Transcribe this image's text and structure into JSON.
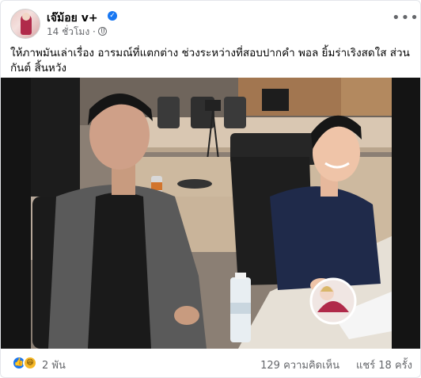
{
  "post": {
    "author": "เจ๊ม้อย v+",
    "time": "14 ชั่วโมง",
    "privacy_icon": "globe-icon",
    "verified_icon": "verified-badge-icon",
    "caption": "ให้ภาพมันเล่าเรื่อง อารมณ์ที่แตกต่าง  ช่วงระหว่างที่สอบปากคำ พอล ยิ้มร่าเริงสดใส ส่วน กันต์ สิ้นหวัง",
    "photo_description_icon": "post-photo",
    "overlay_avatar_icon": "watermark-avatar-icon"
  },
  "stats": {
    "reactions_icons": [
      "like-icon",
      "haha-icon"
    ],
    "reaction_count": "2 พัน",
    "comments": "129 ความคิดเห็น",
    "shares": "แชร์ 18 ครั้ง"
  },
  "colors": {
    "accent": "#1877f2",
    "secondary_text": "#65676b",
    "haha": "#f7b928"
  }
}
